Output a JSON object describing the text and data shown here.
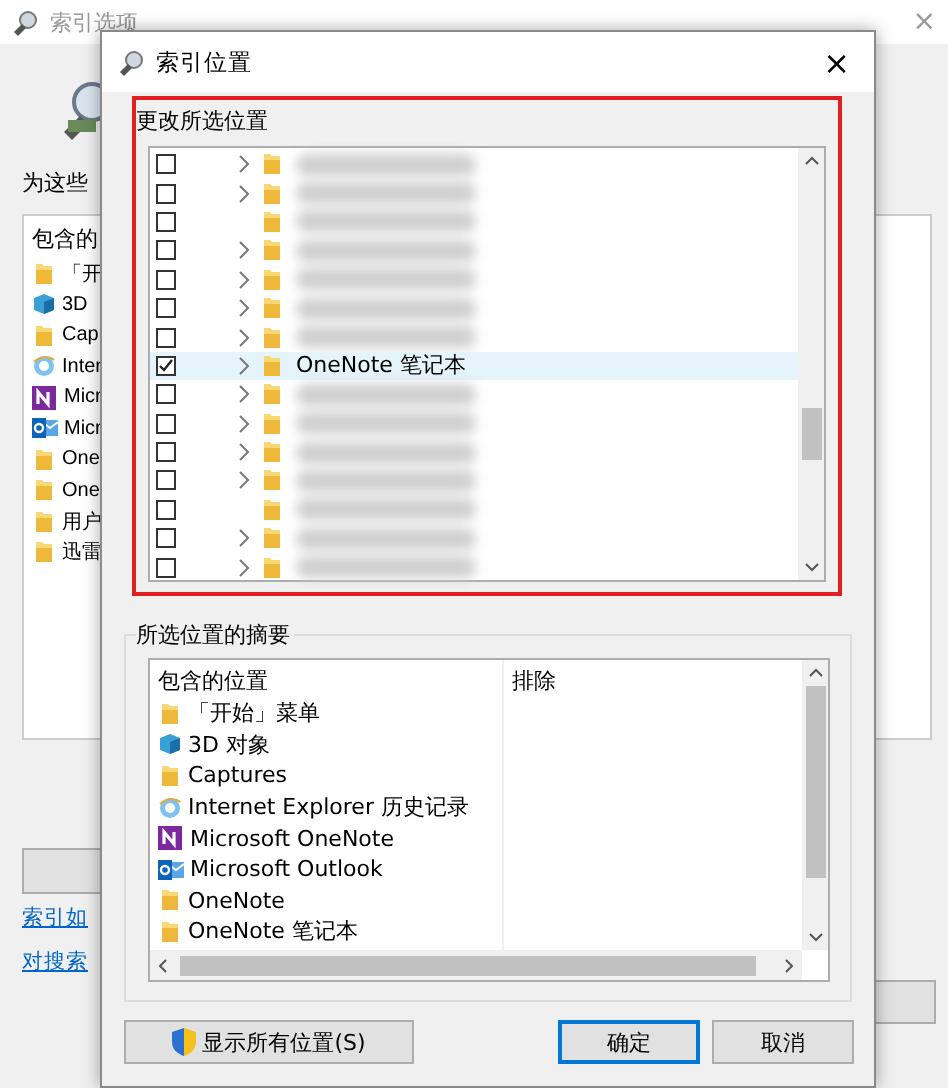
{
  "background_window": {
    "title": "索引选项",
    "close": "×",
    "intro": "为这些",
    "list_header": "包含的",
    "items": [
      {
        "kind": "folder",
        "label": "「开"
      },
      {
        "kind": "cube",
        "label": "3D"
      },
      {
        "kind": "folder",
        "label": "Cap"
      },
      {
        "kind": "ie",
        "label": "Inter"
      },
      {
        "kind": "onenote",
        "label": "Micr"
      },
      {
        "kind": "outlook",
        "label": "Micr"
      },
      {
        "kind": "folder",
        "label": "One"
      },
      {
        "kind": "folder",
        "label": "One"
      },
      {
        "kind": "folder",
        "label": "用户"
      },
      {
        "kind": "folder",
        "label": "迅雷"
      }
    ],
    "links": [
      "索引如",
      "对搜索"
    ]
  },
  "dialog": {
    "title": "索引位置",
    "close": "×",
    "change_group": {
      "label": "更改所选位置",
      "highlighted": true,
      "tree": [
        {
          "checked": false,
          "selected": false,
          "expandable": true,
          "redacted": true
        },
        {
          "checked": false,
          "selected": false,
          "expandable": true,
          "redacted": true
        },
        {
          "checked": false,
          "selected": false,
          "expandable": false,
          "redacted": true
        },
        {
          "checked": false,
          "selected": false,
          "expandable": true,
          "redacted": true
        },
        {
          "checked": false,
          "selected": false,
          "expandable": true,
          "redacted": true
        },
        {
          "checked": false,
          "selected": false,
          "expandable": true,
          "redacted": true
        },
        {
          "checked": false,
          "selected": false,
          "expandable": true,
          "redacted": true
        },
        {
          "checked": true,
          "selected": true,
          "expandable": true,
          "label": "OneNote 笔记本"
        },
        {
          "checked": false,
          "selected": false,
          "expandable": true,
          "redacted": true
        },
        {
          "checked": false,
          "selected": false,
          "expandable": true,
          "redacted": true
        },
        {
          "checked": false,
          "selected": false,
          "expandable": true,
          "redacted": true
        },
        {
          "checked": false,
          "selected": false,
          "expandable": true,
          "redacted": true
        },
        {
          "checked": false,
          "selected": false,
          "expandable": false,
          "redacted": true
        },
        {
          "checked": false,
          "selected": false,
          "expandable": true,
          "redacted": true
        },
        {
          "checked": false,
          "selected": false,
          "expandable": true,
          "redacted": true
        }
      ]
    },
    "summary": {
      "label": "所选位置的摘要",
      "columns": [
        "包含的位置",
        "排除"
      ],
      "included": [
        {
          "kind": "folder",
          "label": "「开始」菜单"
        },
        {
          "kind": "cube",
          "label": "3D 对象"
        },
        {
          "kind": "folder",
          "label": "Captures"
        },
        {
          "kind": "ie",
          "label": "Internet Explorer 历史记录"
        },
        {
          "kind": "onenote",
          "label": "Microsoft OneNote"
        },
        {
          "kind": "outlook",
          "label": "Microsoft Outlook"
        },
        {
          "kind": "folder",
          "label": "OneNote"
        },
        {
          "kind": "folder",
          "label": "OneNote 笔记本"
        }
      ]
    },
    "buttons": [
      {
        "kind": "shield",
        "label": "显示所有位置(S)",
        "default": false
      },
      {
        "kind": "plain",
        "label": "确定",
        "default": true
      },
      {
        "kind": "plain",
        "label": "取消",
        "default": false
      }
    ]
  }
}
